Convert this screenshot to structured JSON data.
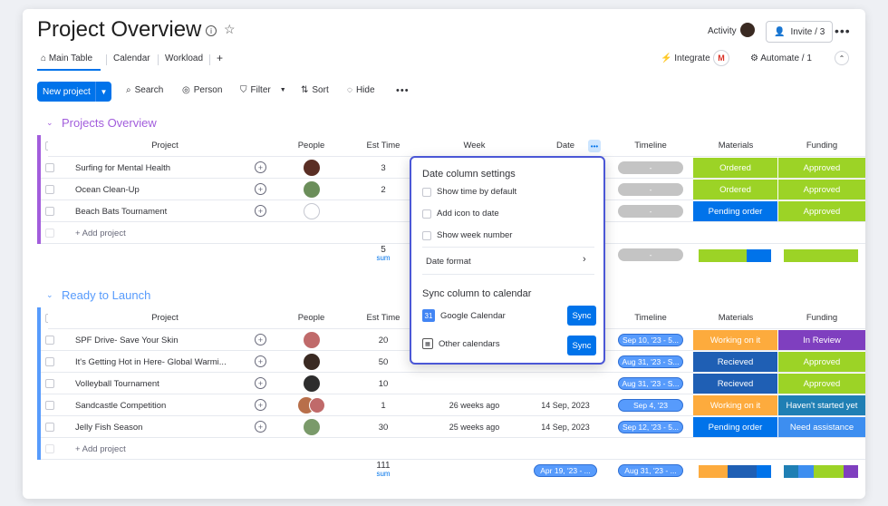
{
  "header": {
    "title": "Project Overview",
    "activity_label": "Activity",
    "invite_label": "Invite / 3",
    "integrate_label": "Integrate",
    "automate_label": "Automate / 1"
  },
  "tabs": [
    "Main Table",
    "Calendar",
    "Workload",
    "+"
  ],
  "toolbar": {
    "new_project": "New project",
    "search": "Search",
    "person": "Person",
    "filter": "Filter",
    "sort": "Sort",
    "hide": "Hide"
  },
  "columns": [
    "Project",
    "People",
    "Est Time",
    "Week",
    "Date",
    "Timeline",
    "Materials",
    "Funding"
  ],
  "groups": [
    {
      "title": "Projects Overview",
      "color": "#a25ddc",
      "add_label": "+ Add project",
      "sum_value": "5",
      "sum_label": "sum",
      "rows": [
        {
          "project": "Surfing for Mental Health",
          "est": "3",
          "week": "",
          "date": "",
          "timeline": "-",
          "materials": "Ordered",
          "funding": "Approved"
        },
        {
          "project": "Ocean Clean-Up",
          "est": "2",
          "week": "",
          "date": "",
          "timeline": "-",
          "materials": "Ordered",
          "funding": "Approved"
        },
        {
          "project": "Beach Bats Tournament",
          "est": "",
          "week": "",
          "date": "",
          "timeline": "-",
          "materials": "Pending order",
          "funding": "Approved"
        }
      ],
      "summary_timeline": "-"
    },
    {
      "title": "Ready to Launch",
      "color": "#579bfc",
      "add_label": "+ Add project",
      "sum_value": "111",
      "sum_label": "sum",
      "rows": [
        {
          "project": "SPF Drive- Save Your Skin",
          "est": "20",
          "week": "",
          "date": "",
          "timeline": "Sep 10, '23 - 5...",
          "materials": "Working on it",
          "funding": "In Review"
        },
        {
          "project": "It's Getting Hot in Here- Global Warmi...",
          "est": "50",
          "week": "",
          "date": "",
          "timeline": "Aug 31, '23 - S...",
          "materials": "Recieved",
          "funding": "Approved"
        },
        {
          "project": "Volleyball Tournament",
          "est": "10",
          "week": "",
          "date": "",
          "timeline": "Aug 31, '23 - S...",
          "materials": "Recieved",
          "funding": "Approved"
        },
        {
          "project": "Sandcastle Competition",
          "est": "1",
          "week": "26 weeks ago",
          "date": "14 Sep, 2023",
          "timeline": "Sep 4, '23",
          "materials": "Working on it",
          "funding": "Haven't started yet"
        },
        {
          "project": "Jelly Fish Season",
          "est": "30",
          "week": "25 weeks ago",
          "date": "14 Sep, 2023",
          "timeline": "Sep 12, '23 - 5...",
          "materials": "Pending order",
          "funding": "Need assistance"
        }
      ],
      "summary_date": "Apr 19, '23 - ...",
      "summary_timeline": "Aug 31, '23 - ..."
    }
  ],
  "date_popup": {
    "title": "Date column settings",
    "options": [
      "Show time by default",
      "Add icon to date",
      "Show week number"
    ],
    "date_format": "Date format",
    "sync_title": "Sync column to calendar",
    "google": "Google Calendar",
    "other": "Other calendars",
    "sync_btn": "Sync"
  },
  "status_colors": {
    "Ordered": "#9cd326",
    "Approved": "#9cd326",
    "Pending order": "#0073ea",
    "Working on it": "#fdab3d",
    "In Review": "#7f3fbf",
    "Recieved": "#1f5fb4",
    "Haven't started yet": "#1f7fb4",
    "Need assistance": "#3d8ef0"
  }
}
